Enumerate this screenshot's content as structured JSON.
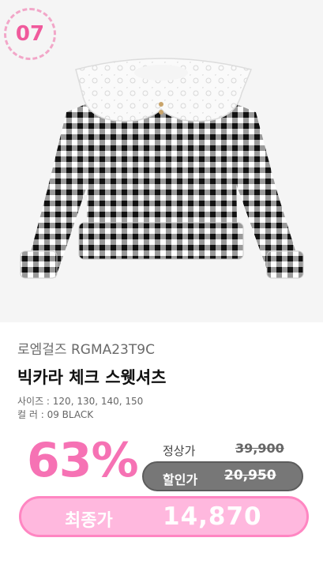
{
  "badge": {
    "number": "07"
  },
  "product": {
    "brand_line": "로엠걸즈 RGMA23T9C",
    "name": "빅카라 체크 스웻셔츠",
    "size_line": "사이즈 : 120, 130, 140, 150",
    "color_line": "컬    러 : 09 BLACK",
    "image_alt": "product-photo-gingham-sweatshirt"
  },
  "pricing": {
    "discount": "63%",
    "regular_label": "정상가",
    "regular_price": "39,900",
    "sale_label": "할인가",
    "sale_price": "20,950",
    "final_label": "최종가",
    "final_price": "14,870"
  },
  "colors": {
    "accent_pink": "#f672b4",
    "badge_border": "#f2a6c8",
    "final_pill": "#ffb8de",
    "sale_pill": "#777777"
  }
}
